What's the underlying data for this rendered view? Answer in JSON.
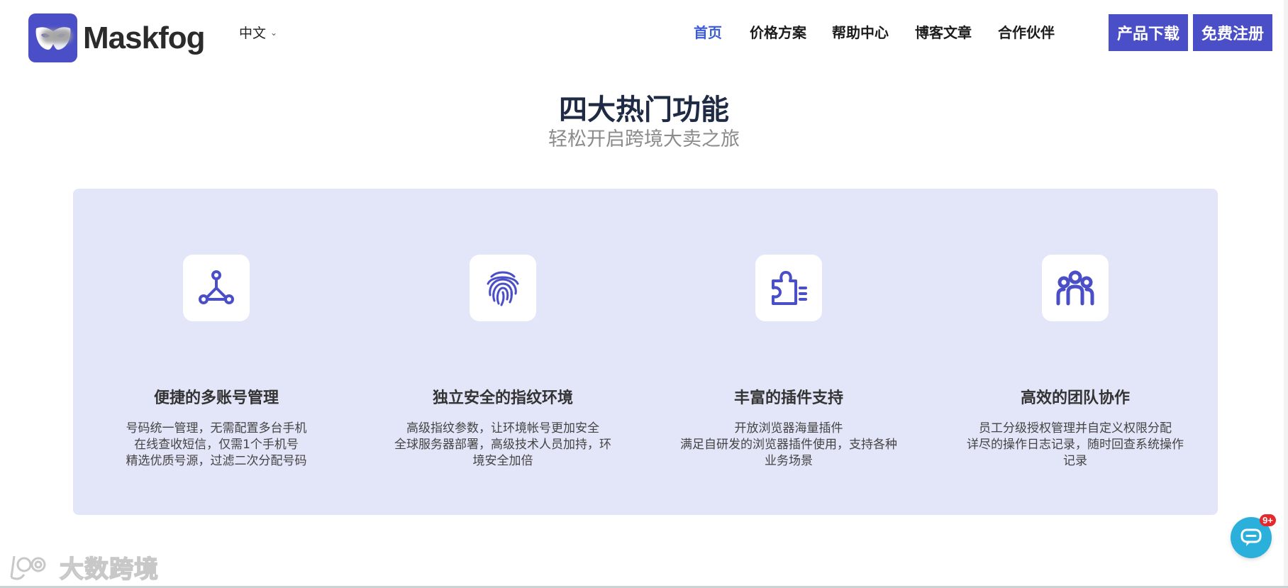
{
  "header": {
    "logo_text": "Maskfog",
    "language": "中文",
    "nav": [
      {
        "label": "首页",
        "active": true
      },
      {
        "label": "价格方案"
      },
      {
        "label": "帮助中心"
      },
      {
        "label": "博客文章"
      },
      {
        "label": "合作伙伴"
      }
    ],
    "download_label": "产品下载",
    "register_label": "免费注册"
  },
  "section": {
    "title": "四大热门功能",
    "subtitle": "轻松开启跨境大卖之旅"
  },
  "features": [
    {
      "icon": "network-icon",
      "title": "便捷的多账号管理",
      "lines": [
        "号码统一管理，无需配置多台手机",
        "在线查收短信，仅需1个手机号",
        "精选优质号源，过滤二次分配号码"
      ]
    },
    {
      "icon": "fingerprint-icon",
      "title": "独立安全的指纹环境",
      "lines": [
        "高级指纹参数，让环境帐号更加安全",
        "全球服务器部署，高级技术人员加持，环",
        "境安全加倍"
      ]
    },
    {
      "icon": "puzzle-plugin-icon",
      "title": "丰富的插件支持",
      "lines": [
        "开放浏览器海量插件",
        "满足自研发的浏览器插件使用，支持各种",
        "业务场景"
      ]
    },
    {
      "icon": "team-icon",
      "title": "高效的团队协作",
      "lines": [
        "员工分级授权管理并自定义权限分配",
        "详尽的操作日志记录，随时回查系统操作",
        "记录"
      ]
    }
  ],
  "chat": {
    "badge": "9+"
  },
  "watermark": {
    "text": "大数跨境"
  },
  "colors": {
    "accent": "#4a4fc8",
    "active_nav": "#3b5bdb",
    "panel": "#e3e5f8",
    "chat": "#2bb0db"
  }
}
